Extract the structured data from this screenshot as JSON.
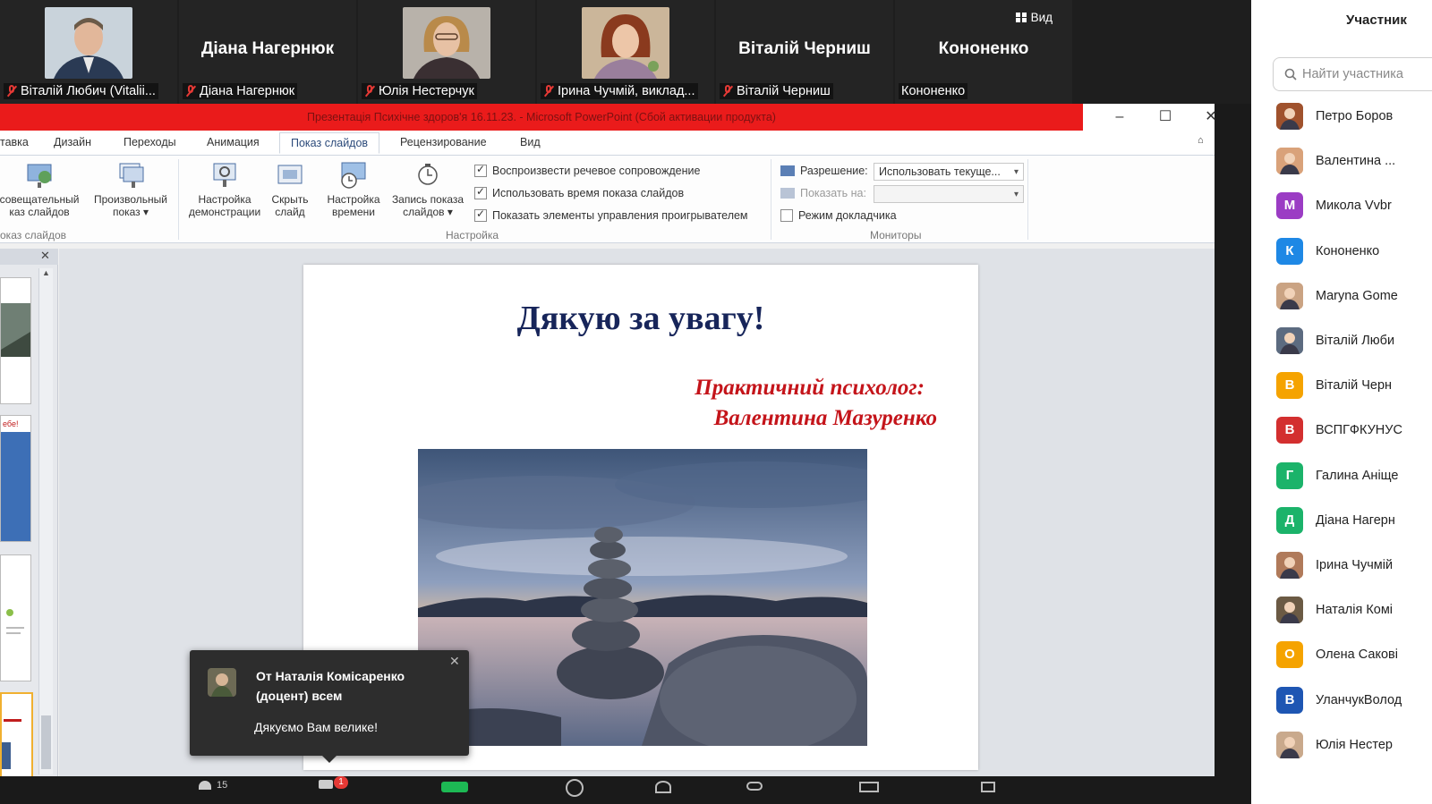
{
  "gallery": {
    "tiles": [
      {
        "label": "Віталій Любич (Vitalii..."
      },
      {
        "big_name": "Діана Нагернюк",
        "label": "Діана Нагернюк"
      },
      {
        "label": "Юлія Нестерчук"
      },
      {
        "label": "Ірина Чучмій, виклад..."
      },
      {
        "big_name": "Віталій Черниш",
        "label": "Віталій Черниш"
      },
      {
        "big_name": "Кононенко",
        "label": "Кононенко"
      }
    ],
    "view_button": "Вид"
  },
  "powerpoint": {
    "title": "Презентація Психічне здоров'я 16.11.23. - Microsoft PowerPoint (Сбой активации продукта)",
    "tabs": [
      "тавка",
      "Дизайн",
      "Переходы",
      "Анимация",
      "Показ слайдов",
      "Рецензирование",
      "Вид"
    ],
    "active_tab": "Показ слайдов",
    "ribbon": {
      "btn_presenter_1": "совещательный",
      "btn_presenter_2": "каз слайдов",
      "btn_custom_1": "Произвольный",
      "btn_custom_2": "показ ▾",
      "btn_setup_1": "Настройка",
      "btn_setup_2": "демонстрации",
      "btn_hide_1": "Скрыть",
      "btn_hide_2": "слайд",
      "btn_timing_1": "Настройка",
      "btn_timing_2": "времени",
      "btn_record_1": "Запись показа",
      "btn_record_2": "слайдов ▾",
      "chk_narration": "Воспроизвести речевое сопровождение",
      "chk_timings": "Использовать время показа слайдов",
      "chk_controls": "Показать элементы управления проигрывателем",
      "resolution_label": "Разрешение:",
      "resolution_value": "Использовать текуще...",
      "show_on_label": "Показать на:",
      "presenter_mode": "Режим докладчика",
      "group_start": "оказ слайдов",
      "group_setup": "Настройка",
      "group_monitors": "Мониторы"
    },
    "slide": {
      "title": "Дякую за увагу!",
      "subtitle_line1": "Практичний психолог:",
      "subtitle_line2": "Валентина Мазуренко"
    }
  },
  "chat_toast": {
    "from": "От Наталія Комісаренко (доцент) всем",
    "message": "Дякуємо Вам велике!"
  },
  "toolbar": {
    "participants_count": "15",
    "chat_badge": "1"
  },
  "participants": {
    "title": "Участник",
    "search_placeholder": "Найти участника",
    "list": [
      {
        "name": "Петро Боров",
        "avatar": "photo",
        "color": "#a0522d"
      },
      {
        "name": "Валентина ...",
        "avatar": "photo",
        "color": "#d9a27a"
      },
      {
        "name": "Микола Vvbr",
        "avatar": "М",
        "color": "#9b3cc4"
      },
      {
        "name": "Кононенко",
        "avatar": "К",
        "color": "#1e88e5"
      },
      {
        "name": "Maryna Gome",
        "avatar": "photo",
        "color": "#caa383"
      },
      {
        "name": "Віталій Люби",
        "avatar": "photo",
        "color": "#5c6b80"
      },
      {
        "name": "Віталій Черн",
        "avatar": "В",
        "color": "#f5a300"
      },
      {
        "name": "ВСПГФКУНУС",
        "avatar": "В",
        "color": "#d32f2f"
      },
      {
        "name": "Галина Аніще",
        "avatar": "Г",
        "color": "#1bb36a"
      },
      {
        "name": "Діана Нагерн",
        "avatar": "Д",
        "color": "#1bb36a"
      },
      {
        "name": "Ірина Чучмій",
        "avatar": "photo",
        "color": "#b07a5a"
      },
      {
        "name": "Наталія Комі",
        "avatar": "photo",
        "color": "#6b5a44"
      },
      {
        "name": "Олена Сакові",
        "avatar": "О",
        "color": "#f5a300"
      },
      {
        "name": "УланчукВолод",
        "avatar": "В",
        "color": "#1e56b3"
      },
      {
        "name": "Юлія Нестер",
        "avatar": "photo",
        "color": "#c9a98c"
      }
    ]
  }
}
